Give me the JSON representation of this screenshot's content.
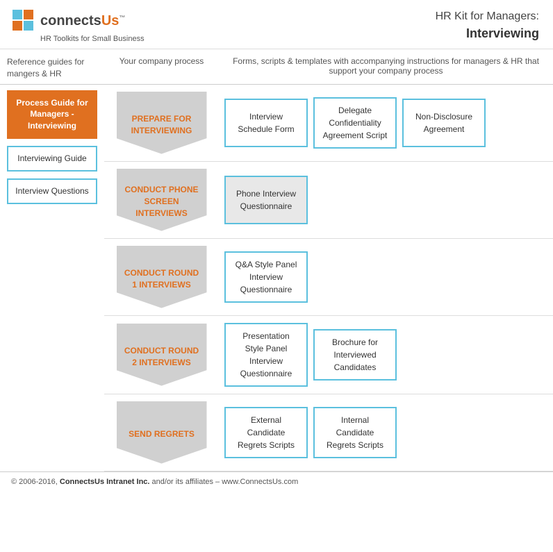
{
  "header": {
    "logo_text": "connects",
    "logo_text2": "Us",
    "logo_tm": "™",
    "tagline": "HR Toolkits for Small Business",
    "title_line1": "HR Kit for Managers:",
    "title_line2": "Interviewing"
  },
  "col_headers": {
    "left": "Reference guides for mangers & HR",
    "process": "Your company process",
    "forms": "Forms, scripts & templates with accompanying instructions for managers & HR that support your company process"
  },
  "sidebar": {
    "items": [
      {
        "label": "Process Guide for Managers - Interviewing",
        "active": true
      },
      {
        "label": "Interviewing Guide",
        "active": false
      },
      {
        "label": "Interview Questions",
        "active": false
      }
    ]
  },
  "process_rows": [
    {
      "process_label": "PREPARE FOR INTERVIEWING",
      "forms": [
        {
          "label": "Interview Schedule Form",
          "highlighted": false
        },
        {
          "label": "Delegate Confidentiality Agreement Script",
          "highlighted": false
        },
        {
          "label": "Non-Disclosure Agreement",
          "highlighted": false
        }
      ]
    },
    {
      "process_label": "CONDUCT PHONE SCREEN INTERVIEWS",
      "forms": [
        {
          "label": "Phone Interview Questionnaire",
          "highlighted": true
        }
      ]
    },
    {
      "process_label": "CONDUCT ROUND 1 INTERVIEWS",
      "forms": [
        {
          "label": "Q&A Style Panel Interview Questionnaire",
          "highlighted": false
        }
      ]
    },
    {
      "process_label": "CONDUCT ROUND 2 INTERVIEWS",
      "forms": [
        {
          "label": "Presentation Style Panel Interview Questionnaire",
          "highlighted": false
        },
        {
          "label": "Brochure for Interviewed Candidates",
          "highlighted": false
        }
      ]
    },
    {
      "process_label": "SEND REGRETS",
      "forms": [
        {
          "label": "External Candidate Regrets Scripts",
          "highlighted": false
        },
        {
          "label": "Internal Candidate Regrets Scripts",
          "highlighted": false
        }
      ]
    }
  ],
  "footer": {
    "text": "© 2006-2016,",
    "company": "ConnectsUs Intranet Inc.",
    "suffix": "and/or its affiliates – www.ConnectsUs.com"
  },
  "colors": {
    "orange": "#e07020",
    "blue": "#5bc0de",
    "gray": "#d0d0d0"
  }
}
